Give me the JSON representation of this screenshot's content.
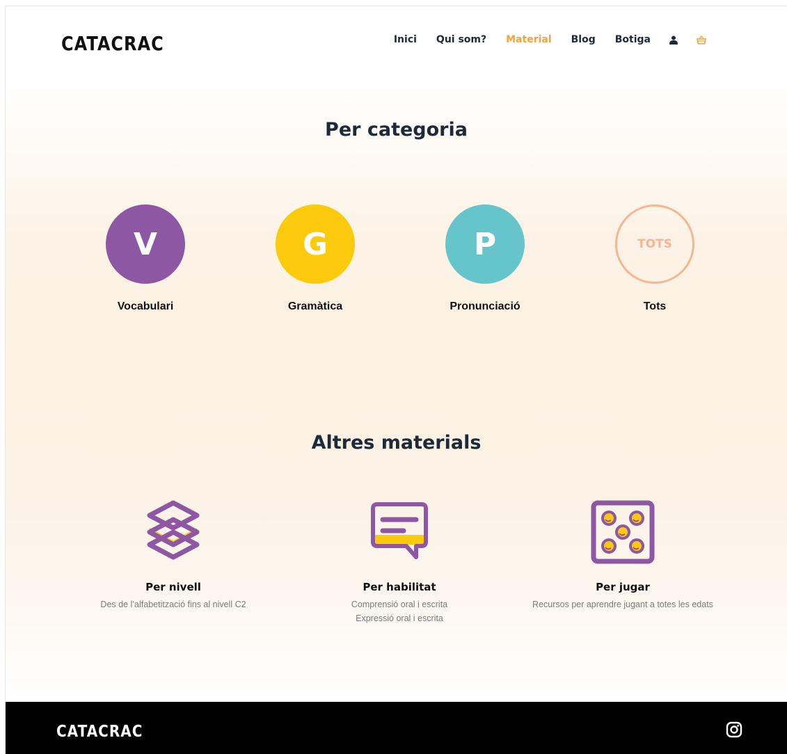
{
  "header": {
    "logo": "CATACRAC",
    "nav": [
      {
        "label": "Inici",
        "active": false
      },
      {
        "label": "Qui som?",
        "active": false
      },
      {
        "label": "Material",
        "active": true
      },
      {
        "label": "Blog",
        "active": false
      },
      {
        "label": "Botiga",
        "active": false
      }
    ],
    "icons": [
      "user-icon",
      "cart-icon"
    ]
  },
  "categories": {
    "title": "Per categoria",
    "items": [
      {
        "letter": "V",
        "label": "Vocabulari",
        "color": "#8e57a3"
      },
      {
        "letter": "G",
        "label": "Gramàtica",
        "color": "#fbcb0b"
      },
      {
        "letter": "P",
        "label": "Pronunciació",
        "color": "#66c5ca"
      },
      {
        "letter": "TOTS",
        "label": "Tots",
        "color": "#f7b693"
      }
    ]
  },
  "materials": {
    "title": "Altres materials",
    "items": [
      {
        "icon": "layers-icon",
        "title": "Per nivell",
        "desc": [
          "Des de l’alfabetització fins al nivell C2"
        ]
      },
      {
        "icon": "chat-icon",
        "title": "Per habilitat",
        "desc": [
          "Comprensió oral i escrita",
          "Expressió oral i escrita"
        ]
      },
      {
        "icon": "dice-icon",
        "title": "Per jugar",
        "desc": [
          "Recursos per aprendre jugant a totes les edats"
        ]
      }
    ]
  },
  "footer": {
    "logo": "CATACRAC",
    "icons": [
      "instagram-icon"
    ]
  },
  "colors": {
    "accent": "#f2a33a",
    "purple": "#8e57a3",
    "yellow": "#fbcb0b",
    "teal": "#66c5ca",
    "peach": "#f7b693",
    "text": "#1d2a3a"
  }
}
